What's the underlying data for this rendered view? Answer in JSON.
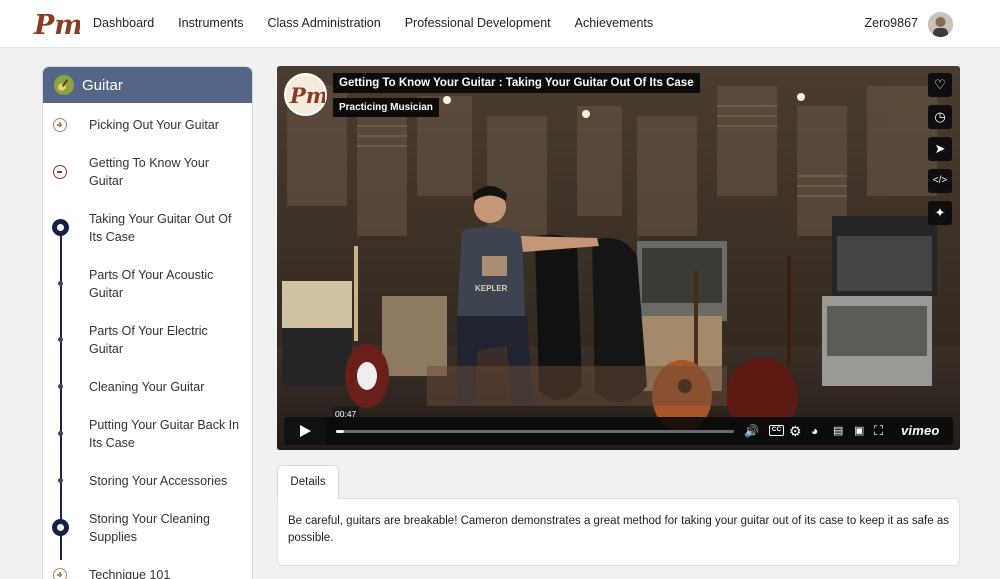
{
  "nav": {
    "items": [
      "Dashboard",
      "Instruments",
      "Class Administration",
      "Professional Development",
      "Achievements"
    ],
    "username": "Zero9867"
  },
  "sidebar": {
    "title": "Guitar",
    "items": [
      {
        "label": "Picking Out Your Guitar",
        "state": "collapsed"
      },
      {
        "label": "Getting To Know Your Guitar",
        "state": "expanded"
      },
      {
        "label": "Taking Your Guitar Out Of Its Case",
        "state": "current"
      },
      {
        "label": "Parts Of Your Acoustic Guitar",
        "state": "lesson"
      },
      {
        "label": "Parts Of Your Electric Guitar",
        "state": "lesson"
      },
      {
        "label": "Cleaning Your Guitar",
        "state": "lesson"
      },
      {
        "label": "Putting Your Guitar Back In Its Case",
        "state": "lesson"
      },
      {
        "label": "Storing Your Accessories",
        "state": "lesson"
      },
      {
        "label": "Storing Your Cleaning Supplies",
        "state": "completed"
      },
      {
        "label": "Technique 101",
        "state": "collapsed"
      }
    ]
  },
  "video": {
    "title": "Getting To Know Your Guitar : Taking Your Guitar Out Of Its Case",
    "channel": "Practicing Musician",
    "current_time": "00:47",
    "progress": 0.02,
    "cc_label": "CC",
    "brand": "vimeo",
    "side_buttons": [
      "heart-icon",
      "clock-icon",
      "send-icon",
      "embed-icon",
      "sparkle-icon"
    ],
    "kepler_text": "KEPLER"
  },
  "details": {
    "tab_label": "Details",
    "text": "Be careful, guitars are breakable! Cameron demonstrates a great method for taking your guitar out of its case to keep it as safe as possible."
  }
}
